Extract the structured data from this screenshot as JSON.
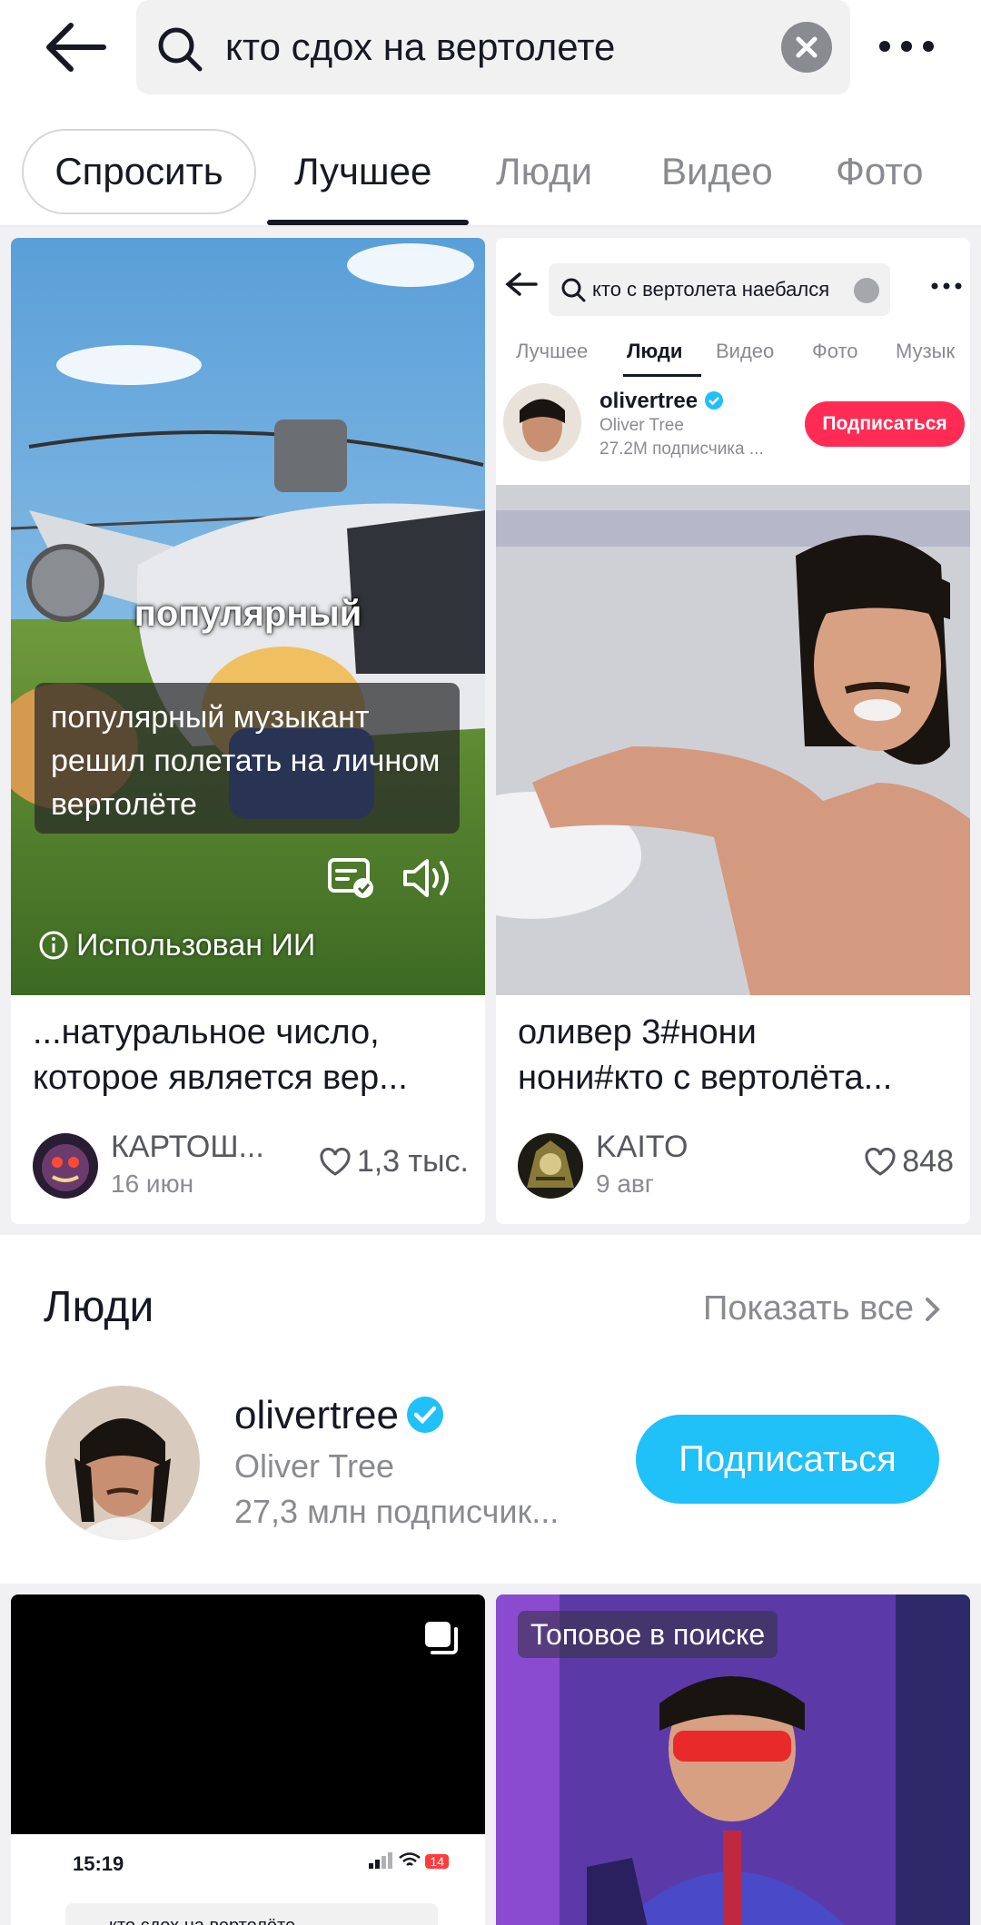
{
  "search": {
    "query": "кто сдох на вертолете"
  },
  "tabs": {
    "ask": "Спросить",
    "items": [
      "Лучшее",
      "Люди",
      "Видео",
      "Фото"
    ]
  },
  "results": [
    {
      "overlay_word": "популярный",
      "caption": "популярный музыкант решил полетать на личном вертолёте",
      "ai_label": "Использован ИИ",
      "title_line1": "...натуральное число,",
      "title_line2": "которое является вер...",
      "author": "КАРТОШ...",
      "date": "16 июн",
      "likes": "1,3 тыс."
    },
    {
      "inner": {
        "query": "кто с вертолета наебался",
        "tabs": [
          "Лучшее",
          "Люди",
          "Видео",
          "Фото",
          "Музык"
        ],
        "username": "olivertree",
        "name": "Oliver Tree",
        "subscribers": "27.2M подписчика ...",
        "follow": "Подписаться"
      },
      "title_line1": "оливер 3#нони",
      "title_line2": "нони#кто с вертолёта...",
      "author": "KAITO",
      "date": "9 авг",
      "likes": "848"
    }
  ],
  "people": {
    "heading": "Люди",
    "show_all": "Показать все",
    "user": {
      "username": "olivertree",
      "name": "Oliver Tree",
      "subscribers": "27,3 млн подписчик...",
      "follow": "Подписаться"
    }
  },
  "bottom": {
    "left_time": "15:19",
    "left_battery": "14",
    "left_query": "кто сдох на вертолёте",
    "right_badge": "Топовое в поиске"
  },
  "colors": {
    "accent_follow": "#20c0f8",
    "inner_follow": "#fe2c55",
    "verified": "#20c0f8"
  }
}
